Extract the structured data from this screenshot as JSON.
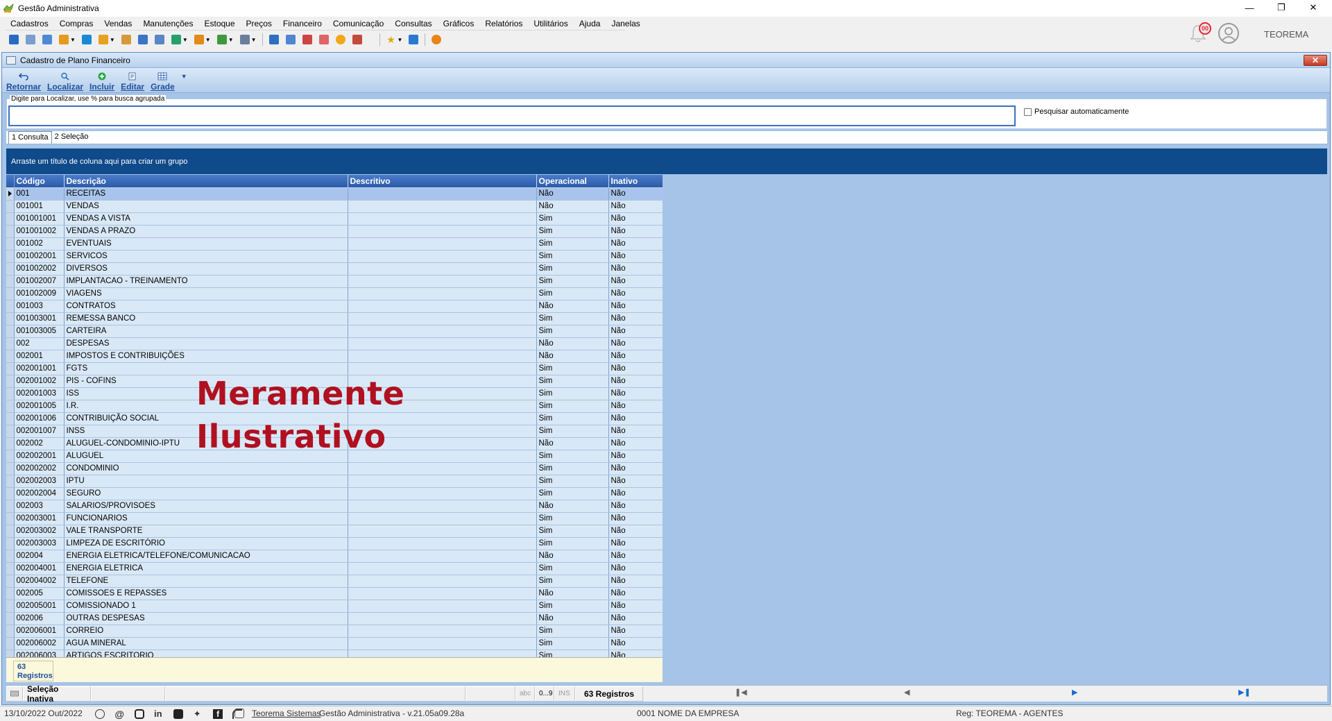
{
  "window": {
    "title": "Gestão Administrativa"
  },
  "menu": [
    "Cadastros",
    "Compras",
    "Vendas",
    "Manutenções",
    "Estoque",
    "Preços",
    "Financeiro",
    "Comunicação",
    "Consultas",
    "Gráficos",
    "Relatórios",
    "Utilitários",
    "Ajuda",
    "Janelas"
  ],
  "notifications": {
    "count": "00"
  },
  "user": {
    "name": "TEOREMA"
  },
  "child": {
    "title": "Cadastro de Plano Financeiro",
    "buttons": {
      "back": "Retornar",
      "find": "Localizar",
      "add": "Incluir",
      "edit": "Editar",
      "grid": "Grade"
    }
  },
  "search": {
    "legend": "Digite para Localizar, use % para busca agrupada",
    "value": "",
    "auto_label": "Pesquisar automaticamente"
  },
  "tabs": [
    "1 Consulta",
    "2 Seleção"
  ],
  "group_panel": "Arraste um título de coluna aqui para criar um grupo",
  "columns": [
    "Código",
    "Descrição",
    "Descritivo",
    "Operacional",
    "Inativo"
  ],
  "rows": [
    [
      "001",
      "RECEITAS",
      "",
      "Não",
      "Não"
    ],
    [
      "001001",
      "VENDAS",
      "",
      "Não",
      "Não"
    ],
    [
      "001001001",
      "VENDAS A VISTA",
      "",
      "Sim",
      "Não"
    ],
    [
      "001001002",
      "VENDAS A PRAZO",
      "",
      "Sim",
      "Não"
    ],
    [
      "001002",
      "EVENTUAIS",
      "",
      "Sim",
      "Não"
    ],
    [
      "001002001",
      "SERVICOS",
      "",
      "Sim",
      "Não"
    ],
    [
      "001002002",
      "DIVERSOS",
      "",
      "Sim",
      "Não"
    ],
    [
      "001002007",
      "IMPLANTACAO - TREINAMENTO",
      "",
      "Sim",
      "Não"
    ],
    [
      "001002009",
      "VIAGENS",
      "",
      "Sim",
      "Não"
    ],
    [
      "001003",
      "CONTRATOS",
      "",
      "Não",
      "Não"
    ],
    [
      "001003001",
      "REMESSA BANCO",
      "",
      "Sim",
      "Não"
    ],
    [
      "001003005",
      "CARTEIRA",
      "",
      "Sim",
      "Não"
    ],
    [
      "002",
      "DESPESAS",
      "",
      "Não",
      "Não"
    ],
    [
      "002001",
      "IMPOSTOS E CONTRIBUIÇÕES",
      "",
      "Não",
      "Não"
    ],
    [
      "002001001",
      "FGTS",
      "",
      "Sim",
      "Não"
    ],
    [
      "002001002",
      "PIS - COFINS",
      "",
      "Sim",
      "Não"
    ],
    [
      "002001003",
      "ISS",
      "",
      "Sim",
      "Não"
    ],
    [
      "002001005",
      "I.R.",
      "",
      "Sim",
      "Não"
    ],
    [
      "002001006",
      "CONTRIBUIÇÃO SOCIAL",
      "",
      "Sim",
      "Não"
    ],
    [
      "002001007",
      "INSS",
      "",
      "Sim",
      "Não"
    ],
    [
      "002002",
      "ALUGUEL-CONDOMINIO-IPTU",
      "",
      "Não",
      "Não"
    ],
    [
      "002002001",
      "ALUGUEL",
      "",
      "Sim",
      "Não"
    ],
    [
      "002002002",
      "CONDOMINIO",
      "",
      "Sim",
      "Não"
    ],
    [
      "002002003",
      "IPTU",
      "",
      "Sim",
      "Não"
    ],
    [
      "002002004",
      "SEGURO",
      "",
      "Sim",
      "Não"
    ],
    [
      "002003",
      "SALARIOS/PROVISOES",
      "",
      "Não",
      "Não"
    ],
    [
      "002003001",
      "FUNCIONARIOS",
      "",
      "Sim",
      "Não"
    ],
    [
      "002003002",
      "VALE TRANSPORTE",
      "",
      "Sim",
      "Não"
    ],
    [
      "002003003",
      "LIMPEZA DE ESCRITÓRIO",
      "",
      "Sim",
      "Não"
    ],
    [
      "002004",
      "ENERGIA ELETRICA/TELEFONE/COMUNICACAO",
      "",
      "Não",
      "Não"
    ],
    [
      "002004001",
      "ENERGIA ELETRICA",
      "",
      "Sim",
      "Não"
    ],
    [
      "002004002",
      "TELEFONE",
      "",
      "Sim",
      "Não"
    ],
    [
      "002005",
      "COMISSOES E REPASSES",
      "",
      "Não",
      "Não"
    ],
    [
      "002005001",
      "COMISSIONADO 1",
      "",
      "Sim",
      "Não"
    ],
    [
      "002006",
      "OUTRAS DESPESAS",
      "",
      "Não",
      "Não"
    ],
    [
      "002006001",
      "CORREIO",
      "",
      "Sim",
      "Não"
    ],
    [
      "002006002",
      "AGUA MINERAL",
      "",
      "Sim",
      "Não"
    ],
    [
      "002006003",
      "ARTIGOS ESCRITORIO",
      "",
      "Sim",
      "Não"
    ]
  ],
  "footer": {
    "count_number": "63",
    "count_label": "Registros"
  },
  "watermark": {
    "line1": "Meramente",
    "line2": "Ilustrativo"
  },
  "statusbar": {
    "selection": "Seleção Inativa",
    "abc": "abc",
    "digits": "0...9",
    "ins": "INS",
    "records": "63 Registros"
  },
  "bottom": {
    "datetime": "13/10/2022 Out/2022",
    "company_link": "Teorema Sistemas",
    "version": "Gestão Administrativa - v.21.05a09.28a",
    "company": "0001 NOME DA EMPRESA",
    "reg": "Reg: TEOREMA - AGENTES"
  }
}
